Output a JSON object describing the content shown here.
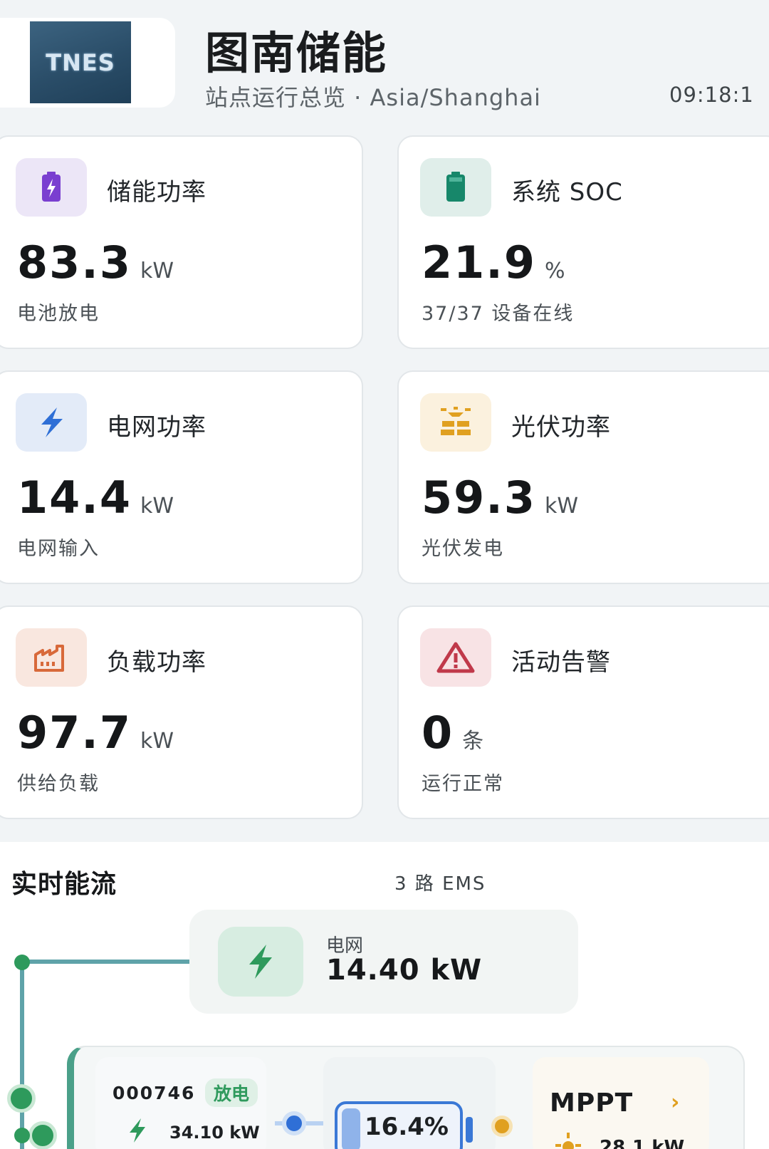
{
  "header": {
    "logo_text": "TNES",
    "title": "图南储能",
    "subtitle": "站点运行总览 · Asia/Shanghai",
    "time": "09:18:1"
  },
  "cards": [
    {
      "title": "储能功率",
      "value": "83.3",
      "unit": "kW",
      "desc": "电池放电",
      "icon": "battery-charging-icon",
      "color": "#7a3fd0"
    },
    {
      "title": "系统 SOC",
      "value": "21.9",
      "unit": "%",
      "desc": "37/37 设备在线",
      "icon": "battery-icon",
      "color": "#17876a"
    },
    {
      "title": "电网功率",
      "value": "14.4",
      "unit": "kW",
      "desc": "电网输入",
      "icon": "lightning-icon",
      "color": "#2f6fd6"
    },
    {
      "title": "光伏功率",
      "value": "59.3",
      "unit": "kW",
      "desc": "光伏发电",
      "icon": "solar-panel-icon",
      "color": "#e0a020"
    },
    {
      "title": "负载功率",
      "value": "97.7",
      "unit": "kW",
      "desc": "供给负载",
      "icon": "factory-icon",
      "color": "#d8693a"
    },
    {
      "title": "活动告警",
      "value": "0",
      "unit": "条",
      "desc": "运行正常",
      "icon": "warning-icon",
      "color": "#c0394a"
    }
  ],
  "flow": {
    "title": "实时能流",
    "ems_count": "3 路 EMS",
    "grid": {
      "label": "电网",
      "value": "14.40 kW"
    },
    "ems": {
      "id": "000746",
      "status": "放电",
      "power": "34.10 kW",
      "soc": "16.4%",
      "soc_fraction": 0.164,
      "mppt_label": "MPPT",
      "mppt_power": "28.1 kW"
    }
  }
}
